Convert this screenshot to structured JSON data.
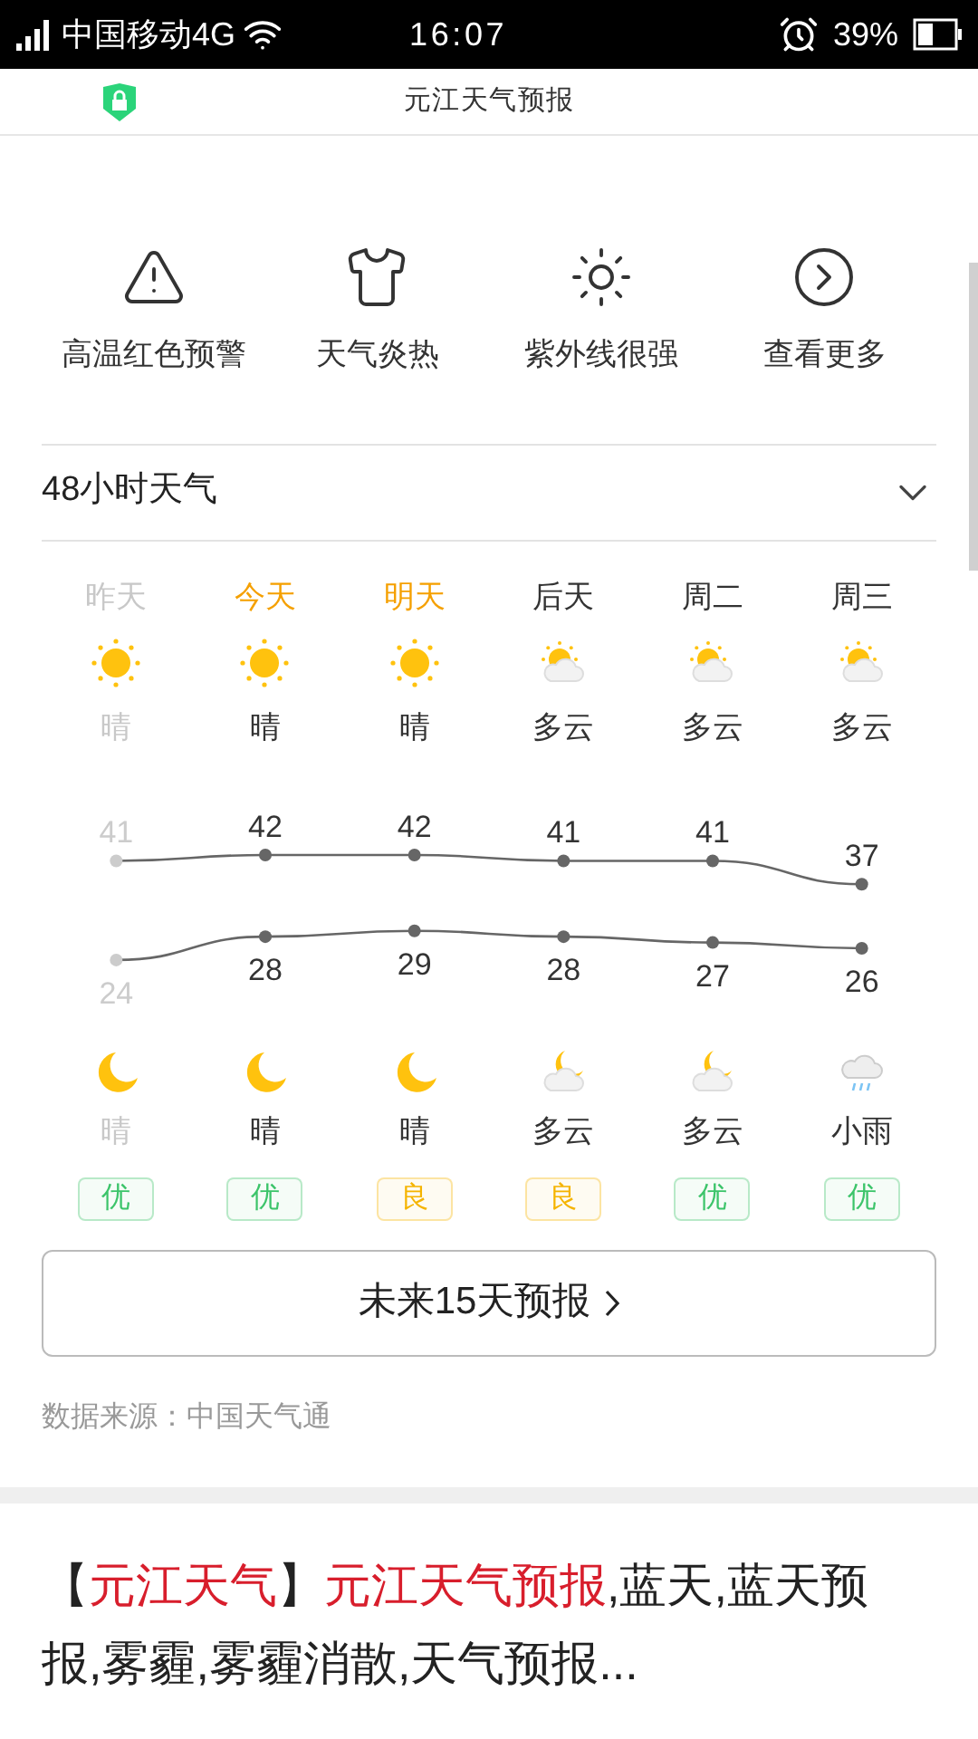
{
  "status_bar": {
    "carrier": "中国移动4G",
    "time": "16:07",
    "battery": "39%"
  },
  "header": {
    "title": "元江天气预报"
  },
  "tips": [
    {
      "label": "高温红色预警",
      "kind": "warning"
    },
    {
      "label": "天气炎热",
      "kind": "shirt"
    },
    {
      "label": "紫外线很强",
      "kind": "sun"
    },
    {
      "label": "查看更多",
      "kind": "more"
    }
  ],
  "forecast": {
    "title": "48小时天气",
    "expanded": false,
    "days": [
      {
        "label": "昨天",
        "past": true,
        "highlighted": false,
        "day": {
          "kind": "sun",
          "weather": "晴"
        },
        "night": {
          "kind": "moon",
          "weather": "晴"
        },
        "aqi": {
          "label": "优",
          "color": "#3cc46a"
        }
      },
      {
        "label": "今天",
        "past": false,
        "highlighted": true,
        "day": {
          "kind": "sun",
          "weather": "晴"
        },
        "night": {
          "kind": "moon",
          "weather": "晴"
        },
        "aqi": {
          "label": "优",
          "color": "#3cc46a"
        }
      },
      {
        "label": "明天",
        "past": false,
        "highlighted": true,
        "day": {
          "kind": "sun",
          "weather": "晴"
        },
        "night": {
          "kind": "moon",
          "weather": "晴"
        },
        "aqi": {
          "label": "良",
          "color": "#f5b400"
        }
      },
      {
        "label": "后天",
        "past": false,
        "highlighted": false,
        "day": {
          "kind": "cloudy",
          "weather": "多云"
        },
        "night": {
          "kind": "moon_cloud",
          "weather": "多云"
        },
        "aqi": {
          "label": "良",
          "color": "#f5b400"
        }
      },
      {
        "label": "周二",
        "past": false,
        "highlighted": false,
        "day": {
          "kind": "cloudy",
          "weather": "多云"
        },
        "night": {
          "kind": "moon_cloud",
          "weather": "多云"
        },
        "aqi": {
          "label": "优",
          "color": "#3cc46a"
        }
      },
      {
        "label": "周三",
        "past": false,
        "highlighted": false,
        "day": {
          "kind": "cloudy",
          "weather": "多云"
        },
        "night": {
          "kind": "rain",
          "weather": "小雨"
        },
        "aqi": {
          "label": "优",
          "color": "#3cc46a"
        }
      }
    ],
    "chart_data": {
      "type": "line",
      "data_labels": true,
      "series": [
        {
          "color": "#666666",
          "marker": true,
          "values": [
            41,
            42,
            42,
            41,
            41,
            37
          ]
        },
        {
          "color": "#666666",
          "marker": true,
          "values": [
            24,
            28,
            29,
            28,
            27,
            26
          ]
        }
      ]
    },
    "more_button": "未来15天预报",
    "source": "数据来源：中国天气通"
  },
  "article": {
    "title": "【**元江天气**】**元江天气预报**,蓝天,蓝天预报,雾霾,雾霾消散,天气预报..."
  }
}
